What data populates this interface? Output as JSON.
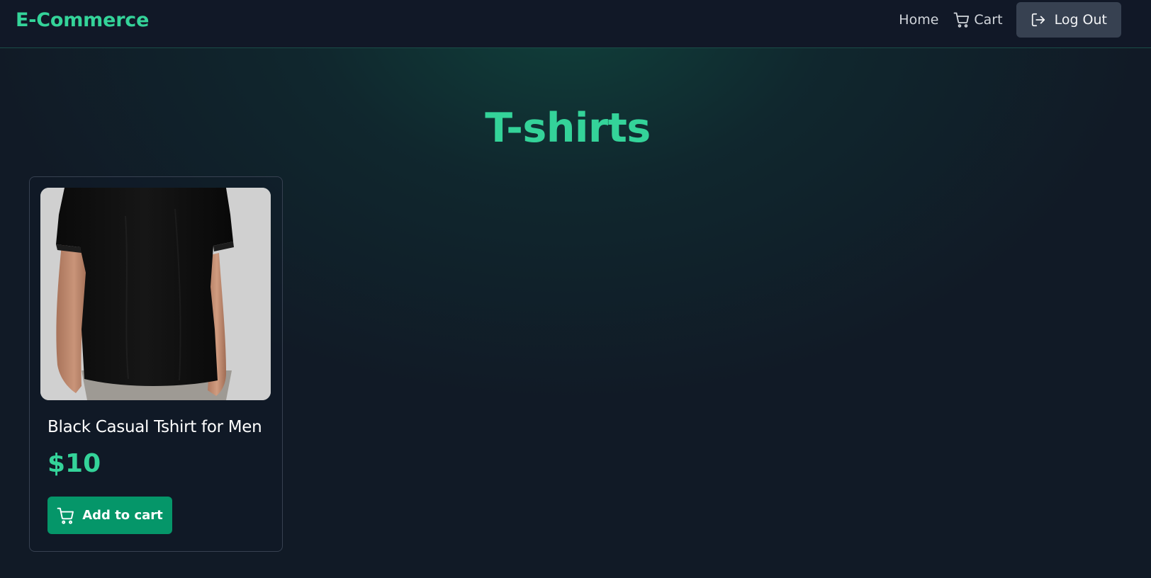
{
  "navbar": {
    "brand": "E-Commerce",
    "links": {
      "home": "Home",
      "cart": "Cart",
      "logout": "Log Out"
    },
    "icons": {
      "cart": "cart-icon",
      "logout": "logout-icon"
    }
  },
  "main": {
    "title": "T-shirts",
    "products": [
      {
        "name": "Black Casual Tshirt for Men",
        "price": "$10",
        "button_label": "Add to cart",
        "button_icon": "cart-icon"
      }
    ]
  },
  "colors": {
    "accent": "#34d399",
    "button": "#059669",
    "background": "#111827",
    "logout_button": "#374151"
  }
}
